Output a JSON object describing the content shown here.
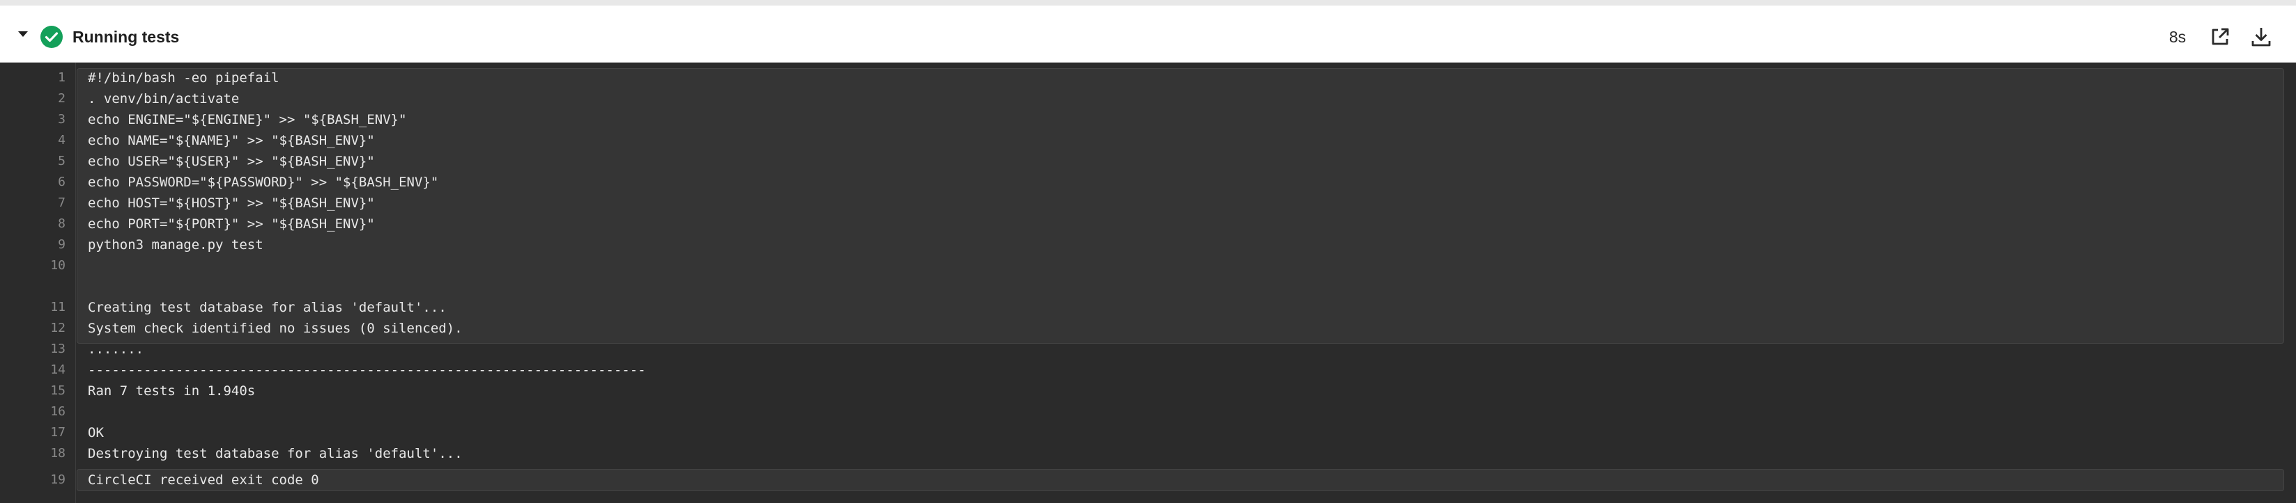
{
  "header": {
    "title": "Running tests",
    "duration": "8s",
    "status": "success",
    "status_color": "#14a05a",
    "icons": [
      "chevron-down-icon",
      "check-circle-icon",
      "open-external-icon",
      "download-icon"
    ]
  },
  "log": {
    "lines": [
      {
        "n": "1",
        "t": "#!/bin/bash -eo pipefail"
      },
      {
        "n": "2",
        "t": ". venv/bin/activate"
      },
      {
        "n": "3",
        "t": "echo ENGINE=\"${ENGINE}\" >> \"${BASH_ENV}\""
      },
      {
        "n": "4",
        "t": "echo NAME=\"${NAME}\" >> \"${BASH_ENV}\""
      },
      {
        "n": "5",
        "t": "echo USER=\"${USER}\" >> \"${BASH_ENV}\""
      },
      {
        "n": "6",
        "t": "echo PASSWORD=\"${PASSWORD}\" >> \"${BASH_ENV}\""
      },
      {
        "n": "7",
        "t": "echo HOST=\"${HOST}\" >> \"${BASH_ENV}\""
      },
      {
        "n": "8",
        "t": "echo PORT=\"${PORT}\" >> \"${BASH_ENV}\""
      },
      {
        "n": "9",
        "t": "python3 manage.py test"
      },
      {
        "n": "10",
        "t": ""
      },
      {
        "n": "11",
        "t": "Creating test database for alias 'default'..."
      },
      {
        "n": "12",
        "t": "System check identified no issues (0 silenced)."
      },
      {
        "n": "13",
        "t": "......."
      },
      {
        "n": "14",
        "t": "----------------------------------------------------------------------"
      },
      {
        "n": "15",
        "t": "Ran 7 tests in 1.940s"
      },
      {
        "n": "16",
        "t": ""
      },
      {
        "n": "17",
        "t": "OK"
      },
      {
        "n": "18",
        "t": "Destroying test database for alias 'default'..."
      },
      {
        "n": "19",
        "t": "CircleCI received exit code 0"
      }
    ]
  }
}
